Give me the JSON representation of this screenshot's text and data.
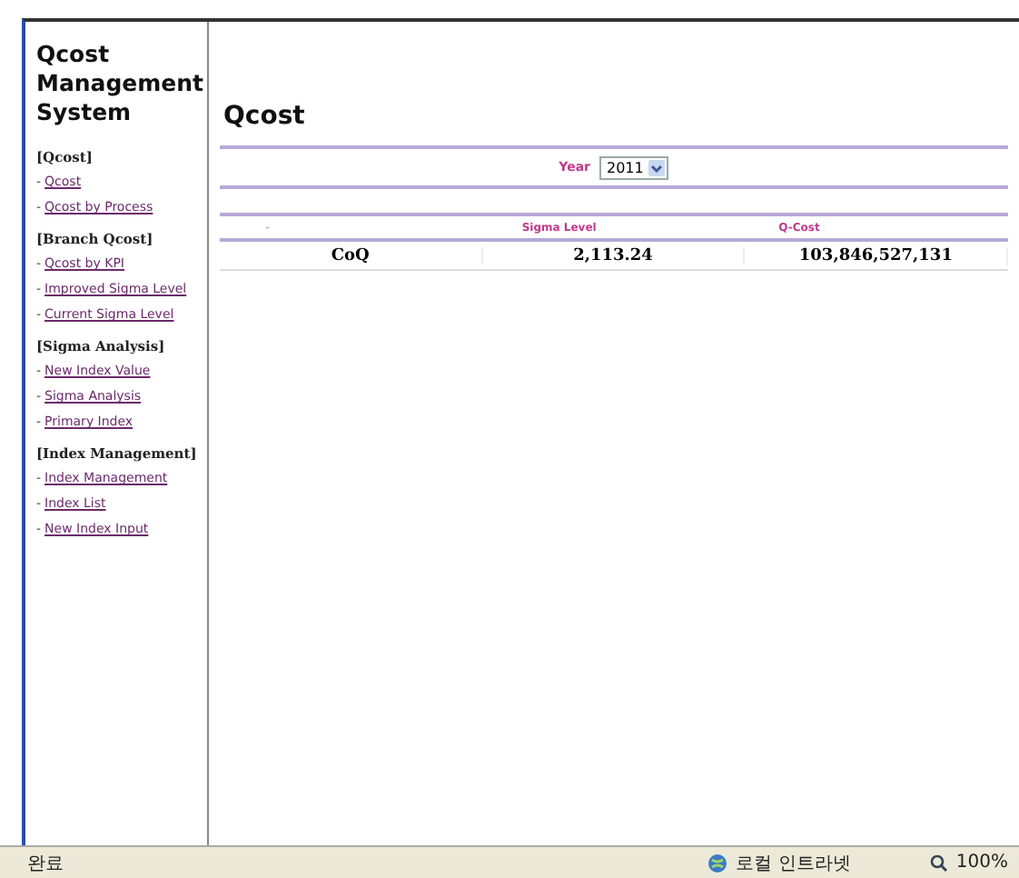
{
  "sidebar": {
    "title": "Qcost Management System",
    "sections": [
      {
        "heading": "[Qcost]",
        "links": [
          {
            "bullet": "-",
            "label": "Qcost"
          },
          {
            "bullet": "-",
            "label": "Qcost by Process"
          }
        ]
      },
      {
        "heading": "[Branch Qcost]",
        "links": [
          {
            "bullet": "-",
            "label": "Qcost by KPI"
          },
          {
            "bullet": "-",
            "label": "Improved Sigma Level"
          },
          {
            "bullet": "-",
            "label": "Current Sigma Level"
          }
        ]
      },
      {
        "heading": "[Sigma Analysis]",
        "links": [
          {
            "bullet": "-",
            "label": "New Index Value"
          },
          {
            "bullet": "-",
            "label": "Sigma Analysis"
          },
          {
            "bullet": "-",
            "label": "Primary Index"
          }
        ]
      },
      {
        "heading": "[Index Management]",
        "links": [
          {
            "bullet": "-",
            "label": "Index Management"
          },
          {
            "bullet": "-",
            "label": "Index List"
          },
          {
            "bullet": "-",
            "label": "New Index Input"
          }
        ]
      }
    ]
  },
  "page": {
    "title": "Qcost",
    "filter": {
      "label": "Year",
      "value": "2011"
    },
    "table": {
      "columns": [
        "-",
        "Sigma Level",
        "Q-Cost"
      ],
      "rows": [
        [
          "CoQ",
          "2,113.24",
          "103,846,527,131"
        ]
      ]
    }
  },
  "status_bar": {
    "status": "완료",
    "zone": "로컬 인트라넷",
    "zoom": "100%"
  }
}
